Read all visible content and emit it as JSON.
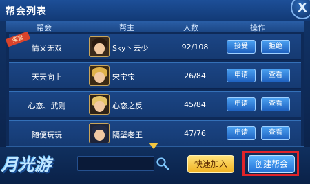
{
  "window": {
    "title": "帮会列表",
    "close_label": "X"
  },
  "table": {
    "headers": [
      "帮会",
      "帮主",
      "人数",
      "操作"
    ],
    "rows": [
      {
        "name": "情义无双",
        "leader": "Sky丶云少",
        "count": "92/108",
        "btn1": "接受",
        "btn2": "拒绝",
        "badge": "荣誉"
      },
      {
        "name": "天天向上",
        "leader": "宋宝宝",
        "count": "26/84",
        "btn1": "申请",
        "btn2": "查看"
      },
      {
        "name": "心恋、武则",
        "leader": "心恋之反",
        "count": "45/84",
        "btn1": "申请",
        "btn2": "查看"
      },
      {
        "name": "随便玩玩",
        "leader": "隔壁老王",
        "count": "47/76",
        "btn1": "申请",
        "btn2": "查看"
      }
    ]
  },
  "footer": {
    "logo": "月光游",
    "search_placeholder": "",
    "quick_join": "快速加入",
    "create_guild": "创建帮会"
  },
  "colors": {
    "accent_yellow": "#f2c640",
    "highlight_red": "#e0242a",
    "button_blue": "#2270d6"
  }
}
